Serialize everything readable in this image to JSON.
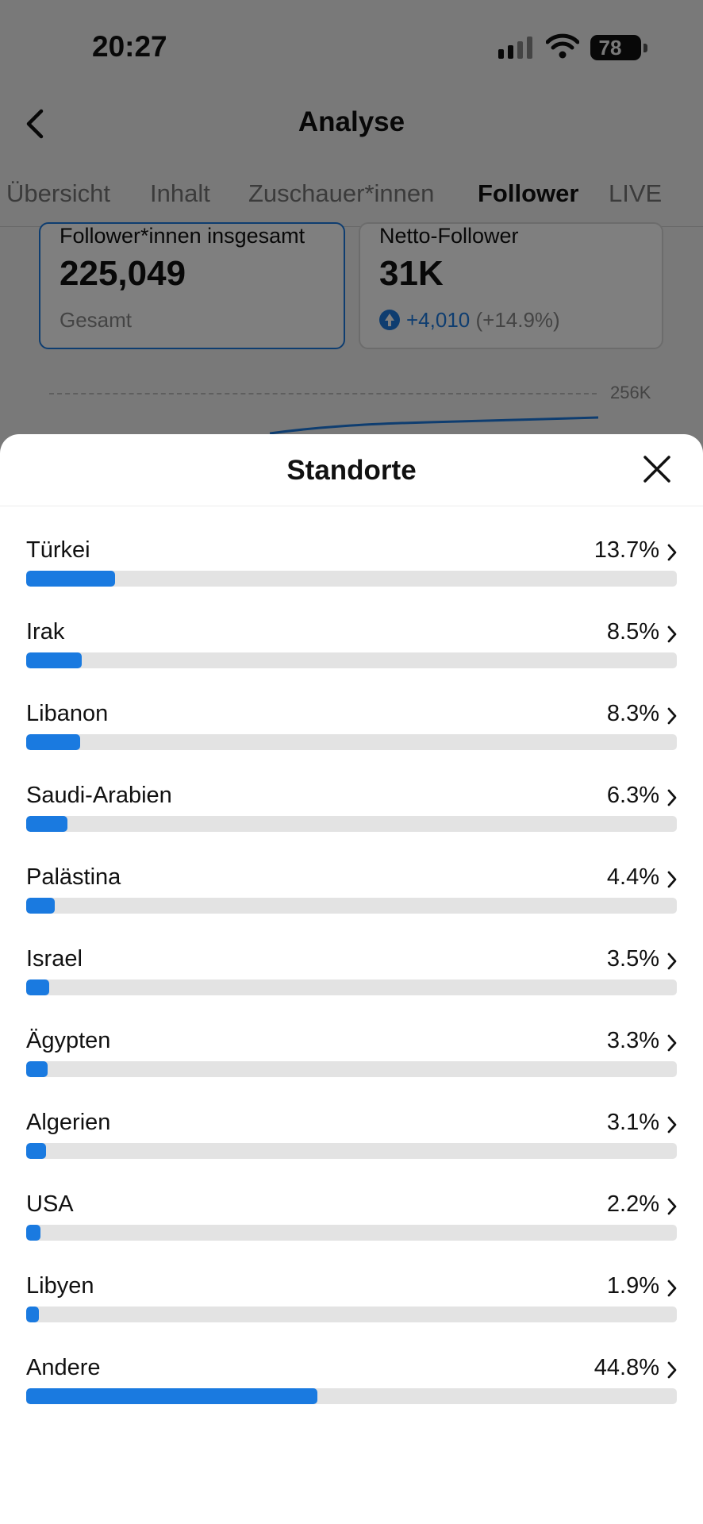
{
  "status_bar": {
    "time": "20:27",
    "battery": "78"
  },
  "nav": {
    "title": "Analyse"
  },
  "tabs": [
    {
      "label": "Übersicht",
      "active": false
    },
    {
      "label": "Inhalt",
      "active": false
    },
    {
      "label": "Zuschauer*innen",
      "active": false
    },
    {
      "label": "Follower",
      "active": true
    },
    {
      "label": "LIVE",
      "active": false
    }
  ],
  "cards": {
    "total": {
      "label": "Follower*innen insgesamt",
      "value": "225,049",
      "sub": "Gesamt"
    },
    "net": {
      "label": "Netto-Follower",
      "value": "31K",
      "delta": "+4,010",
      "delta_pct": "(+14.9%)"
    }
  },
  "chart": {
    "y_max_label": "256K"
  },
  "sheet": {
    "title": "Standorte",
    "locations": [
      {
        "name": "Türkei",
        "pct_label": "13.7%",
        "pct": 13.7
      },
      {
        "name": "Irak",
        "pct_label": "8.5%",
        "pct": 8.5
      },
      {
        "name": "Libanon",
        "pct_label": "8.3%",
        "pct": 8.3
      },
      {
        "name": "Saudi-Arabien",
        "pct_label": "6.3%",
        "pct": 6.3
      },
      {
        "name": "Palästina",
        "pct_label": "4.4%",
        "pct": 4.4
      },
      {
        "name": "Israel",
        "pct_label": "3.5%",
        "pct": 3.5
      },
      {
        "name": "Ägypten",
        "pct_label": "3.3%",
        "pct": 3.3
      },
      {
        "name": "Algerien",
        "pct_label": "3.1%",
        "pct": 3.1
      },
      {
        "name": "USA",
        "pct_label": "2.2%",
        "pct": 2.2
      },
      {
        "name": "Libyen",
        "pct_label": "1.9%",
        "pct": 1.9
      },
      {
        "name": "Andere",
        "pct_label": "44.8%",
        "pct": 44.8
      }
    ]
  },
  "colors": {
    "accent": "#1a7ae0",
    "track": "#e3e3e3"
  }
}
